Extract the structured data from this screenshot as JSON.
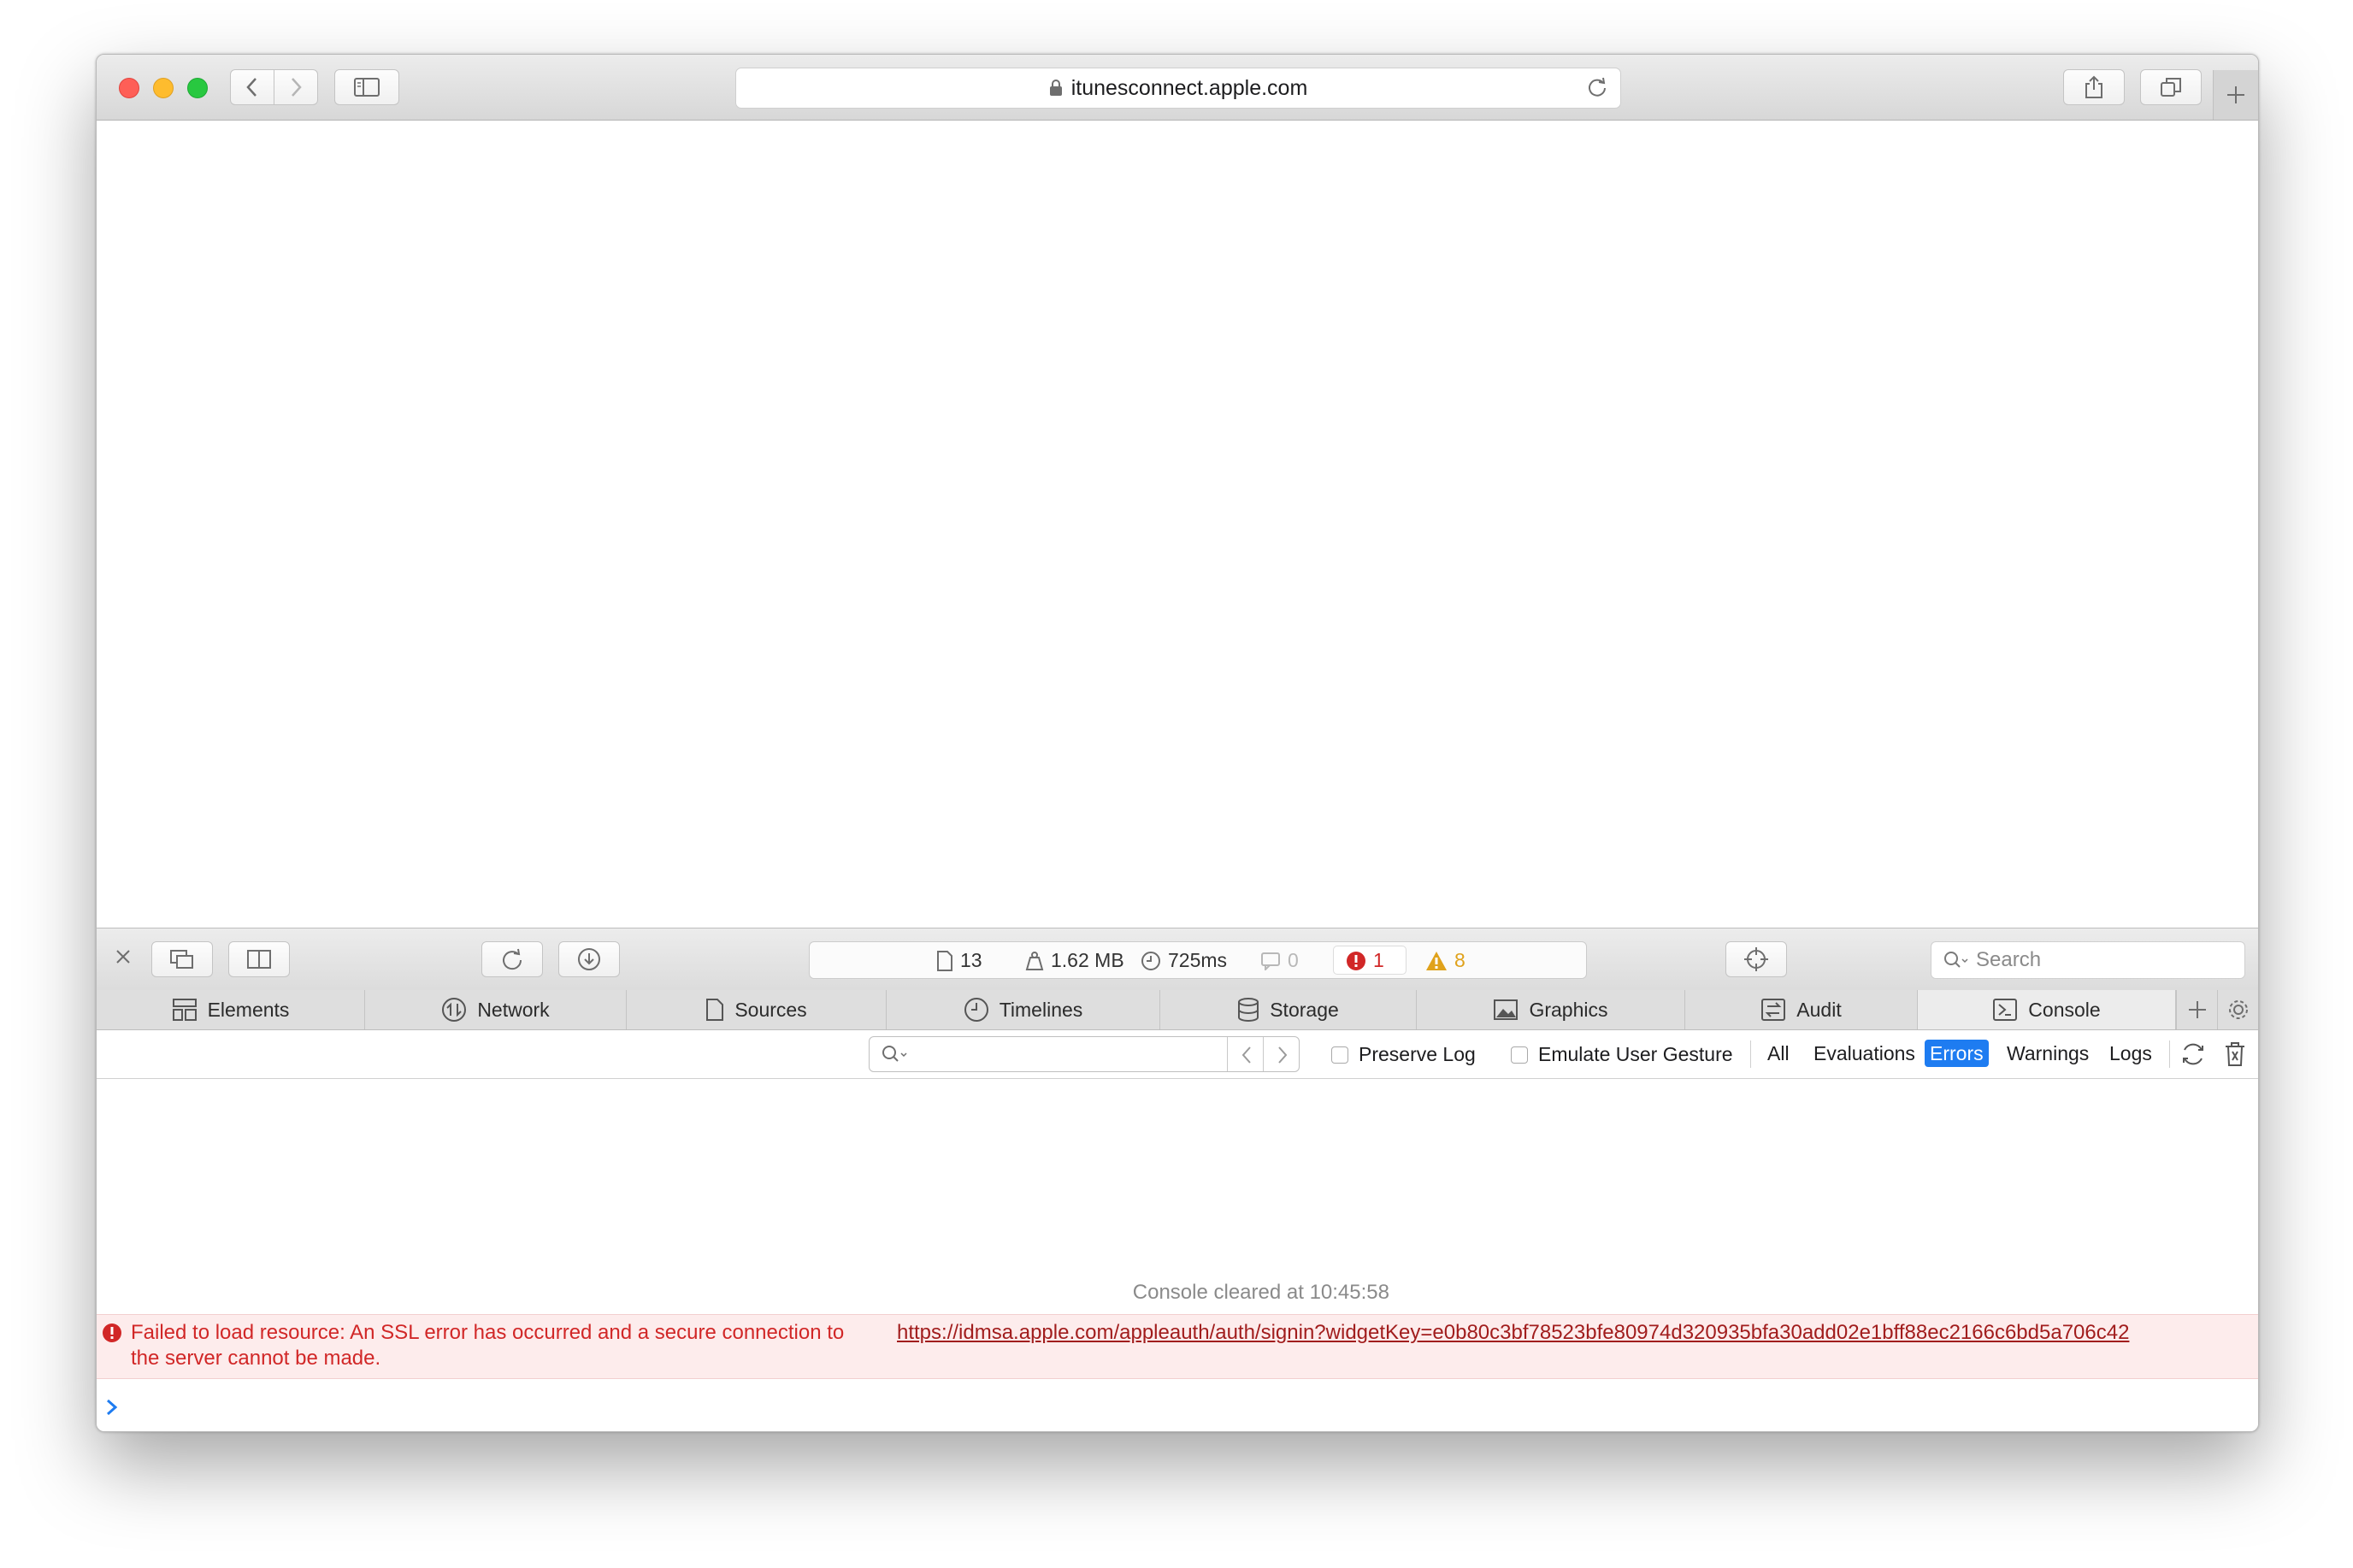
{
  "browser": {
    "url": "itunesconnect.apple.com"
  },
  "dashboard": {
    "resources": "13",
    "size": "1.62 MB",
    "time": "725ms",
    "logs": "0",
    "errors": "1",
    "warnings": "8"
  },
  "inspector": {
    "search_placeholder": "Search",
    "tabs": [
      {
        "label": "Elements"
      },
      {
        "label": "Network"
      },
      {
        "label": "Sources"
      },
      {
        "label": "Timelines"
      },
      {
        "label": "Storage"
      },
      {
        "label": "Graphics"
      },
      {
        "label": "Audit"
      },
      {
        "label": "Console"
      }
    ],
    "active_tab": "Console"
  },
  "console_filter": {
    "preserve_log": "Preserve Log",
    "emulate_gesture": "Emulate User Gesture",
    "levels": [
      "All",
      "Evaluations",
      "Errors",
      "Warnings",
      "Logs"
    ],
    "selected_level": "Errors"
  },
  "console": {
    "cleared_text": "Console cleared at 10:45:58",
    "error_line1": "Failed to load resource: An SSL error has occurred and a secure connection to",
    "error_line2": "the server cannot be made.",
    "error_url": "https://idmsa.apple.com/appleauth/auth/signin?widgetKey=e0b80c3bf78523bfe80974d320935bfa30add02e1bff88ec2166c6bd5a706c42"
  },
  "colors": {
    "accent": "#1e7cf1",
    "error": "#d12727",
    "warning": "#e0a21b"
  }
}
